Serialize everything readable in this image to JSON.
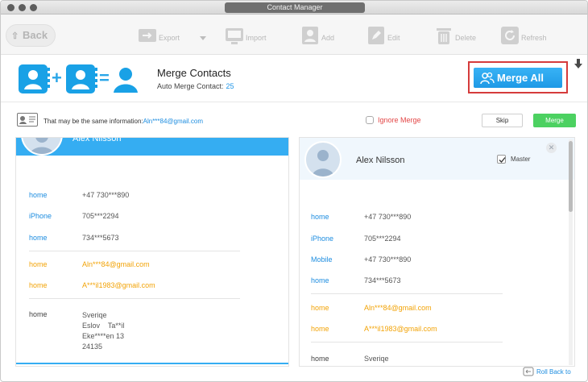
{
  "window": {
    "title": "Contact Manager"
  },
  "toolbar": {
    "back": "Back",
    "export": "Export",
    "import": "Import",
    "add": "Add",
    "edit": "Edit",
    "delete": "Delete",
    "refresh": "Refresh"
  },
  "header": {
    "title": "Merge Contacts",
    "auto_merge_label": "Auto Merge Contact:",
    "auto_merge_count": "25",
    "merge_all": "Merge All"
  },
  "info": {
    "text": "That may be the same information:",
    "email": "Aln***84@gmail.com",
    "ignore_merge": "Ignore Merge",
    "skip": "Skip",
    "merge": "Merge"
  },
  "left_contact": {
    "name": "Alex Nilsson",
    "phones": [
      {
        "label": "home",
        "value": "+47 730***890"
      },
      {
        "label": "iPhone",
        "value": "705***2294"
      },
      {
        "label": "home",
        "value": "734***5673"
      }
    ],
    "emails": [
      {
        "label": "home",
        "value": "Aln***84@gmail.com"
      },
      {
        "label": "home",
        "value": "A***il1983@gmail.com"
      }
    ],
    "address": {
      "label": "home",
      "lines": "Sveriqe\nEslov    Ta**il\nEke****en 13\n24135"
    }
  },
  "right_contact": {
    "name": "Alex Nilsson",
    "master_label": "Master",
    "master_checked": true,
    "phones": [
      {
        "label": "home",
        "value": "+47 730***890"
      },
      {
        "label": "iPhone",
        "value": "705***2294"
      },
      {
        "label": "Mobile",
        "value": "+47 730***890"
      },
      {
        "label": "home",
        "value": "734***5673"
      }
    ],
    "emails": [
      {
        "label": "home",
        "value": "Aln***84@gmail.com"
      },
      {
        "label": "home",
        "value": "A***il1983@gmail.com"
      }
    ],
    "address": {
      "label": "home",
      "first_line": "Sveriqe"
    }
  },
  "footer": {
    "roll_back": "Roll Back to"
  },
  "colors": {
    "accent": "#35adf2",
    "merge_green": "#4cd161",
    "email_amber": "#f2a307",
    "ignore_red": "#e34646",
    "highlight_outline": "#d53b3b"
  },
  "icons": {
    "export": "export-icon",
    "import": "import-icon",
    "add": "add-contact-icon",
    "edit": "edit-icon",
    "delete": "trash-icon",
    "refresh": "refresh-icon",
    "merge_all": "people-icon",
    "download": "download-arrow-icon",
    "info": "id-card-icon",
    "rollback": "rollback-icon",
    "close": "close-icon"
  }
}
